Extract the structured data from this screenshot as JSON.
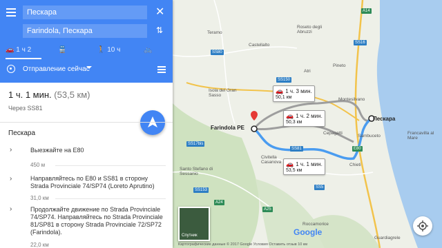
{
  "search": {
    "origin": "Пескара",
    "destination": "Farindola, Пескара"
  },
  "modes": [
    {
      "name": "car",
      "label": "1 ч 2"
    },
    {
      "name": "transit",
      "label": ""
    },
    {
      "name": "walk",
      "label": "10 ч"
    },
    {
      "name": "bike",
      "label": ""
    }
  ],
  "depart": {
    "label": "Отправление сейчас"
  },
  "summary": {
    "time": "1 ч. 1 мин.",
    "distance": "(53,5 км)",
    "via": "Через SS81"
  },
  "route": {
    "start": "Пескара",
    "steps": [
      {
        "text": "Выезжайте на E80",
        "distance": "450 м"
      },
      {
        "text": "Направляйтесь по E80 и SS81 в сторону Strada Provinciale 74/SP74 (Loreto Aprutino)",
        "distance": "31,0 км"
      },
      {
        "text": "Продолжайте движение по Strada Provinciale 74/SP74. Направляйтесь по Strada Provinciale 81/SP81 в сторону Strada Provinciale 72/SP72 (Farindola).",
        "distance": "22,0 км"
      }
    ]
  },
  "map": {
    "cities": {
      "pescara": "Пескара",
      "farindola": "Farindola PE"
    },
    "places": {
      "montesilvano": "Montesilvano",
      "francavilla": "Francavilla al Mare",
      "chieti": "Chieti",
      "civitella": "Civitella Casanova",
      "cepagatti": "Cepagatti",
      "sambuceto": "Sambuceto",
      "teramo": "Teramo",
      "castellalto": "Castellalto",
      "roseto": "Roseto degli Abruzzi",
      "atri": "Atri",
      "pineto": "Pineto",
      "santo_stefano": "Santo Stefano di Sessanio",
      "roccamorice": "Roccamorice",
      "guardiagrele": "Guardiagrele",
      "isola": "Isola del Gran Sasso"
    },
    "callouts": {
      "route1": {
        "time": "1 ч. 1 мин.",
        "dist": "53,5 км"
      },
      "route2": {
        "time": "1 ч. 2 мин.",
        "dist": "50,3 км"
      },
      "route3": {
        "time": "1 ч. 3 мин.",
        "dist": "50,1 км"
      }
    },
    "shields": [
      "A14",
      "SS16",
      "SS80",
      "SS81",
      "E80",
      "SS5",
      "SS17bis",
      "SS153",
      "A24",
      "SS150",
      "A25"
    ],
    "satellite_label": "Спутник",
    "google_logo": "Google",
    "copyright": "Картографические данные © 2017 Google  Условия  Оставить отзыв  10 км"
  },
  "colors": {
    "accent": "#4285f4",
    "route_primary": "#4a9cf0",
    "route_alt": "#9e9e9e"
  }
}
